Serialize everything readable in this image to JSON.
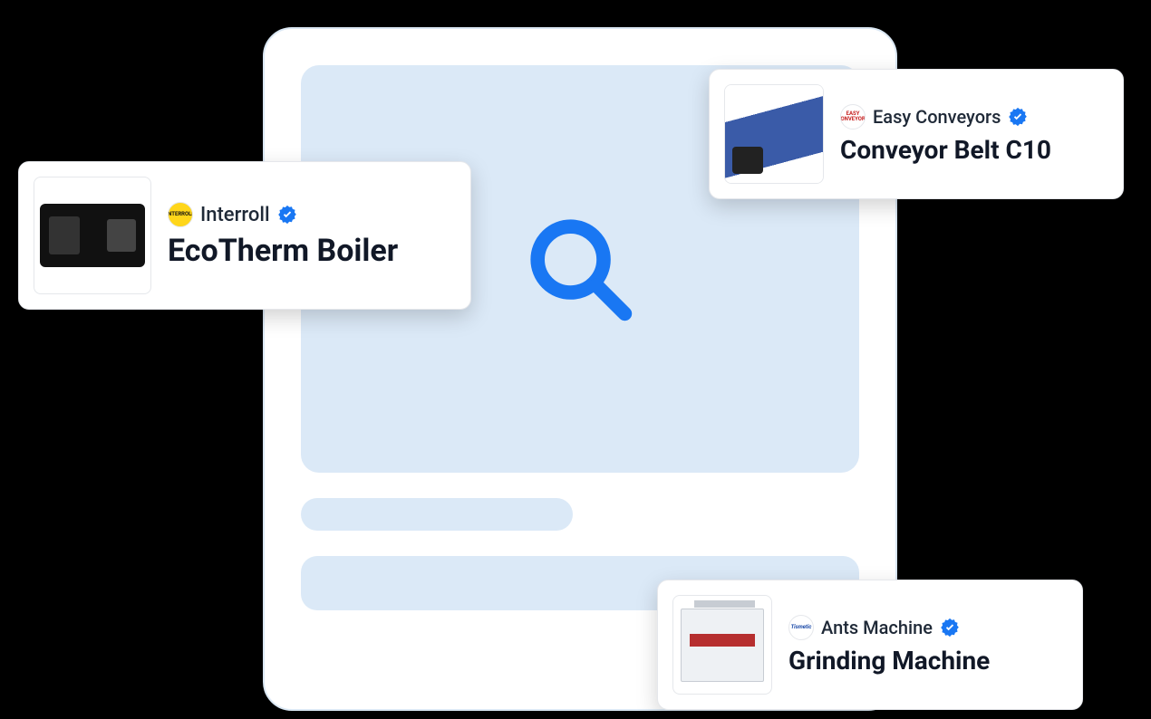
{
  "cards": [
    {
      "company": "Interroll",
      "product": "EcoTherm Boiler",
      "logoText": "INTERROLL",
      "logoClass": "logo-interroll",
      "thumbClass": "thumb-ecotherm",
      "verified": true
    },
    {
      "company": "Easy Conveyors",
      "product": "Conveyor Belt C10",
      "logoText": "EASY CONVEYORS",
      "logoClass": "logo-easyconv",
      "thumbClass": "thumb-conveyor",
      "verified": true
    },
    {
      "company": "Ants Machine",
      "product": "Grinding Machine",
      "logoText": "Tismetic",
      "logoClass": "logo-ants",
      "thumbClass": "thumb-grinder",
      "verified": true
    }
  ]
}
